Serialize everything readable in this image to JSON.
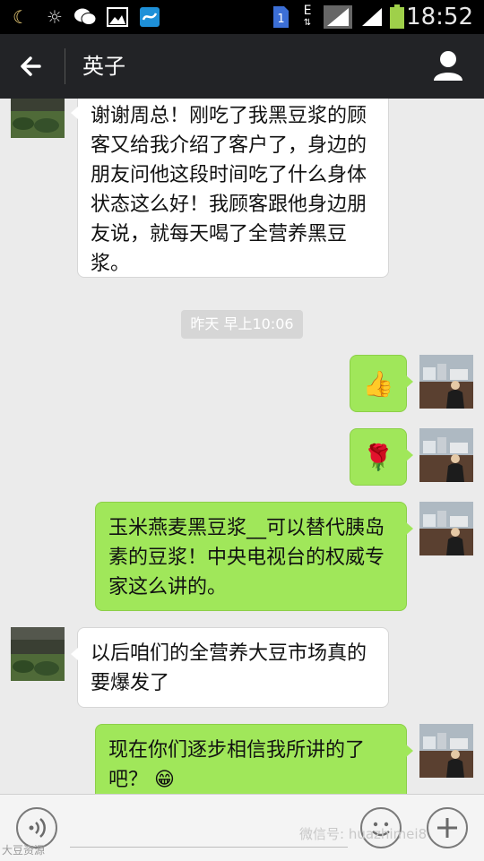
{
  "status_bar": {
    "time": "18:52",
    "sim_badge": "1",
    "network_letter": "E",
    "icons": [
      "moon-icon",
      "brightness-icon",
      "wechat-icon",
      "gallery-icon",
      "app-icon",
      "sim-icon",
      "network-e-icon",
      "signal-icon",
      "signal-icon-2",
      "battery-icon"
    ]
  },
  "header": {
    "title": "英子",
    "back_icon": "back-arrow-icon",
    "profile_icon": "person-icon"
  },
  "messages": [
    {
      "side": "left",
      "sender": "英子",
      "text": "谢谢周总！刚吃了我黑豆浆的顾客又给我介绍了客户了，身边的朋友问他这段时间吃了什么身体状态这么好！我顾客跟他身边朋友说，就每天喝了全营养黑豆浆。"
    },
    {
      "type": "time",
      "text": "昨天 早上10:06"
    },
    {
      "side": "right",
      "type": "emoji",
      "emoji": "👍",
      "icon": "thumbs-up-icon"
    },
    {
      "side": "right",
      "type": "emoji",
      "emoji": "🌹",
      "icon": "rose-icon"
    },
    {
      "side": "right",
      "text": "玉米燕麦黑豆浆__可以替代胰岛素的豆浆！中央电视台的权威专家这么讲的。"
    },
    {
      "side": "left",
      "sender": "英子",
      "text": "以后咱们的全营养大豆市场真的要爆发了"
    },
    {
      "side": "right",
      "text": "现在你们逐步相信我所讲的了吧？",
      "emoji": "😁"
    }
  ],
  "input_bar": {
    "voice_icon": "voice-icon",
    "emoji_icon": "smiley-icon",
    "more_icon": "plus-icon"
  },
  "watermarks": {
    "right": "微信号: huazhimei8",
    "left": "大豆资源"
  },
  "colors": {
    "header_bg": "#222326",
    "chat_bg": "#ebebeb",
    "green_bubble": "#a0e75a",
    "white_bubble": "#ffffff"
  }
}
